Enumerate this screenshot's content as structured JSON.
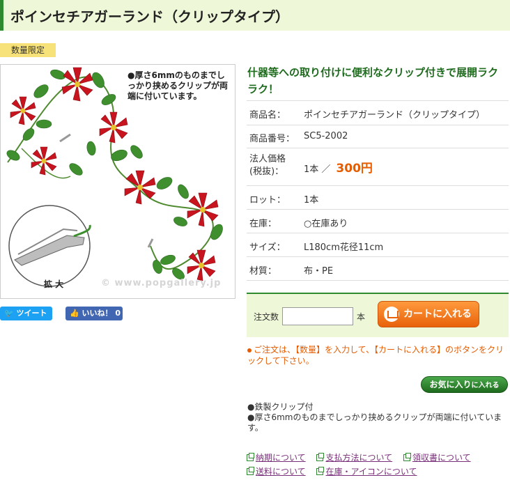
{
  "page": {
    "title": "ポインセチアガーランド（クリップタイプ）",
    "badge": "数量限定"
  },
  "photo": {
    "note": "●厚さ6mmのものまでしっかり挟めるクリップが両端に付いています。",
    "zoom_label": "拡 大",
    "watermark": "© www.popgallery.jp"
  },
  "social": {
    "tweet_label": "ツイート",
    "like_label": "いいね！ 0"
  },
  "headline": "什器等への取り付けに便利なクリップ付きで展開ラクラク！",
  "spec": {
    "rows": [
      {
        "label": "商品名：",
        "value": "ポインセチアガーランド（クリップタイプ）"
      },
      {
        "label": "商品番号：",
        "value": "SC5-2002"
      },
      {
        "label": "法人価格\n(税抜)：",
        "value": "1本 ／",
        "price": "300円"
      },
      {
        "label": "ロット：",
        "value": "1本"
      },
      {
        "label": "在庫：",
        "value": "○在庫あり"
      },
      {
        "label": "サイズ：",
        "value": "L180cm花径11cm"
      },
      {
        "label": "材質：",
        "value": "布・PE"
      }
    ]
  },
  "order": {
    "qty_label": "注文数",
    "qty_value": "",
    "unit": "本",
    "cart_button": "カートに入れる"
  },
  "notice": "ご注文は、【数量】を入力して、【カートに入れる】のボタンをクリックして下さい。",
  "favorite_button": {
    "main": "お気に入り",
    "sub": "に入れる"
  },
  "features": [
    "●鉄製クリップ付",
    "●厚さ6mmのものまでしっかり挟めるクリップが両端に付いています。"
  ],
  "links": [
    "納期について",
    "支払方法について",
    "領収書について",
    "送料について",
    "在庫・アイコンについて"
  ],
  "colors": {
    "accent_green": "#2f8a2f",
    "title_bg": "#eef8d8",
    "price_orange": "#e65c00",
    "badge_yellow": "#f7e27a"
  }
}
